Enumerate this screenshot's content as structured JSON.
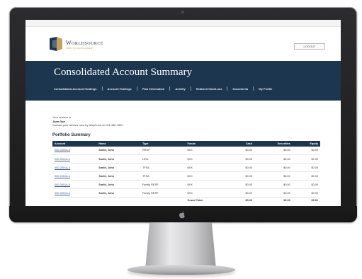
{
  "brand": {
    "name": "Worldsource",
    "tagline": "WEALTH MANAGEMENT",
    "colors": {
      "navy": "#1c3650",
      "gold": "#c4a35c"
    }
  },
  "header": {
    "logout_label": "LOGOUT"
  },
  "banner": {
    "title": "Consolidated Account Summary"
  },
  "nav": [
    {
      "label": "Consolidated Account Holdings"
    },
    {
      "label": "Account Holdings"
    },
    {
      "label": "Plan Information"
    },
    {
      "label": "Activity"
    },
    {
      "label": "Realized Gain/Loss"
    },
    {
      "label": "Documents"
    },
    {
      "label": "My Profile"
    }
  ],
  "advisor": {
    "intro": "Your advisor is:",
    "name": "Jane Doe",
    "contact": "Contact your advisor now by telephone at 123-456-7890"
  },
  "portfolio": {
    "title": "Portfolio Summary",
    "columns": [
      "Account",
      "Name",
      "Type",
      "Funds",
      "Cash",
      "Securities",
      "Equity"
    ],
    "rows": [
      [
        "000-0001A-0",
        "Smith, John",
        "RRSP",
        "$XX",
        "$0.00",
        "$0.00",
        "$0.00"
      ],
      [
        "000-0001A-0",
        "Smith, John",
        "LIRA",
        "$XX",
        "$0.00",
        "$0.00",
        "$0.00"
      ],
      [
        "000-0001A-0",
        "Smith, John",
        "TFSA",
        "$XX",
        "$0.00",
        "$0.00",
        "$0.00"
      ],
      [
        "000-0001A-0",
        "Smith, John",
        "TFSA",
        "$XX",
        "$0.00",
        "$0.00",
        "$0.00"
      ],
      [
        "000-0001A-0",
        "Smith, John",
        "Family RESP",
        "$XX",
        "$0.00",
        "$0.00",
        "$0.00"
      ],
      [
        "000-0001A-0",
        "Smith, John",
        "Family RESP",
        "$XX",
        "$0.00",
        "$0.00",
        "$0.00"
      ]
    ],
    "total": {
      "label": "Grand Total:",
      "cash": "$0.00",
      "securities": "$0.00",
      "equity": "$0.00"
    }
  },
  "device": {
    "logo_icon": "apple-logo-icon"
  }
}
